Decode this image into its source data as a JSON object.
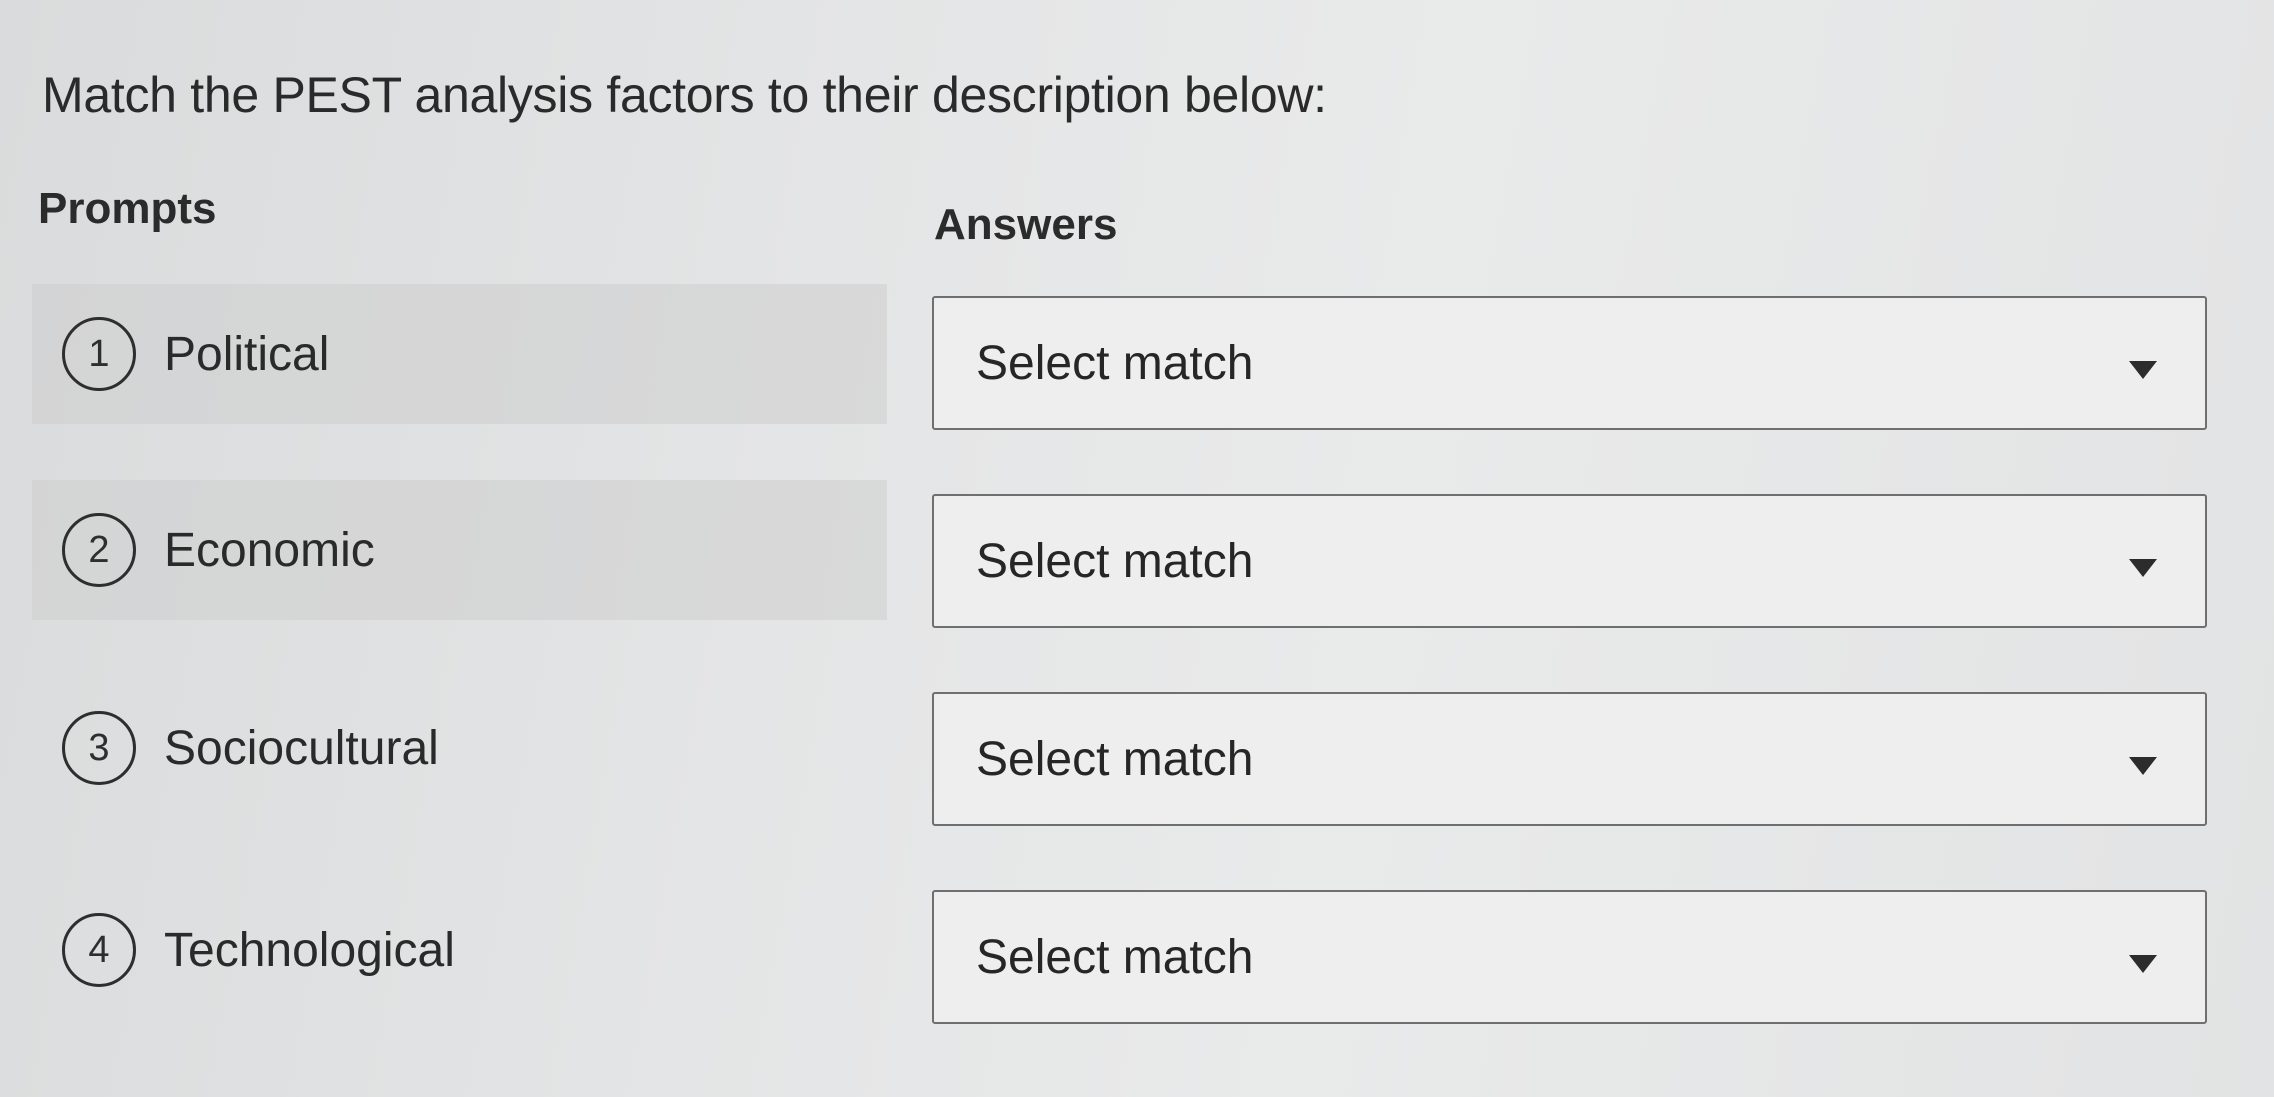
{
  "question": "Match the PEST analysis factors to their description below:",
  "headers": {
    "prompts": "Prompts",
    "answers": "Answers"
  },
  "prompts": [
    {
      "number": "1",
      "label": "Political"
    },
    {
      "number": "2",
      "label": "Economic"
    },
    {
      "number": "3",
      "label": "Sociocultural"
    },
    {
      "number": "4",
      "label": "Technological"
    }
  ],
  "answers": [
    {
      "value": "Select match",
      "icon": "caret-down-icon"
    },
    {
      "value": "Select match",
      "icon": "caret-down-icon"
    },
    {
      "value": "Select match",
      "icon": "caret-down-icon"
    },
    {
      "value": "Select match",
      "icon": "caret-down-icon"
    }
  ]
}
